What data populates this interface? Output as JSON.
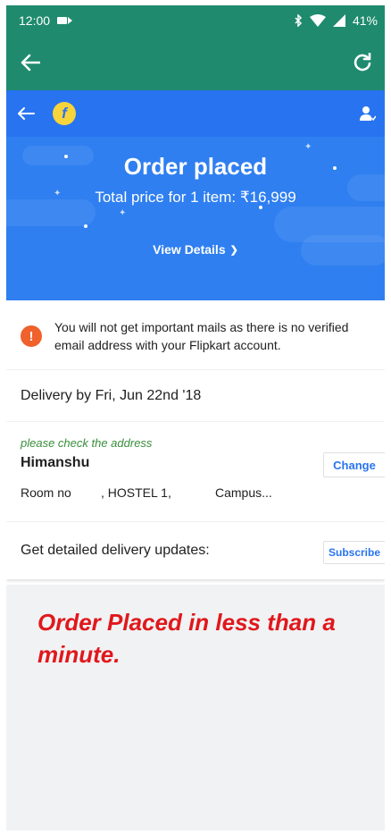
{
  "status_bar": {
    "time": "12:00",
    "battery": "41%"
  },
  "hero": {
    "title": "Order placed",
    "price_text": "Total price for 1 item: ₹16,999",
    "view_details": "View Details",
    "link_chevron": "❯"
  },
  "notice": {
    "icon": "!",
    "text": "You will not get important mails as there is no verified email address with your Flipkart account."
  },
  "delivery": {
    "text": "Delivery by Fri, Jun 22nd '18"
  },
  "address": {
    "note": "please check the address",
    "name": "Himanshu",
    "change_label": "Change",
    "line_part1": "Room no",
    "line_part2": ", HOSTEL 1,",
    "line_part3": "Campus..."
  },
  "updates": {
    "text": "Get detailed delivery updates:",
    "subscribe_label": "Subscribe"
  },
  "caption": {
    "text": "Order Placed in less than a minute."
  },
  "icons": {
    "back": "arrow-left-icon",
    "refresh": "refresh-icon",
    "logo": "flipkart-logo-icon",
    "account": "account-icon",
    "bluetooth": "bluetooth-icon",
    "wifi": "wifi-icon",
    "signal": "signal-icon",
    "battery": "battery-icon",
    "camera": "camera-icon"
  },
  "colors": {
    "status_bar": "#1f8a6e",
    "header": "#2874f0",
    "hero": "#2f7ff0",
    "info": "#f0612b",
    "note_green": "#388e3c",
    "caption_red": "#e0181c",
    "background_grey": "#f1f2f4"
  }
}
